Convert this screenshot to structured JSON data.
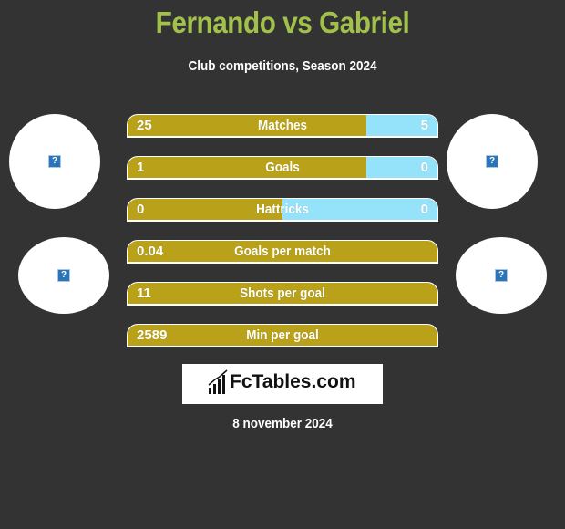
{
  "header": {
    "title": "Fernando vs Gabriel",
    "subtitle": "Club competitions, Season 2024"
  },
  "colors": {
    "title": "#a2c14a",
    "left_bar": "#b9a21a",
    "right_bar": "#95e2fb",
    "background": "#333333"
  },
  "players": {
    "left": {
      "avatar_icon": "missing-image-icon",
      "club_icon": "missing-image-icon"
    },
    "right": {
      "avatar_icon": "missing-image-icon",
      "club_icon": "missing-image-icon"
    }
  },
  "stats": [
    {
      "label": "Matches",
      "left": "25",
      "right": "5",
      "right_share": 0.23
    },
    {
      "label": "Goals",
      "left": "1",
      "right": "0",
      "right_share": 0.23
    },
    {
      "label": "Hattricks",
      "left": "0",
      "right": "0",
      "right_share": 0.5
    },
    {
      "label": "Goals per match",
      "left": "0.04",
      "right": "",
      "right_share": 0
    },
    {
      "label": "Shots per goal",
      "left": "11",
      "right": "",
      "right_share": 0
    },
    {
      "label": "Min per goal",
      "left": "2589",
      "right": "",
      "right_share": 0
    }
  ],
  "logo": {
    "text": "FcTables.com",
    "icon": "bar-chart-icon"
  },
  "footer": {
    "date": "8 november 2024"
  }
}
